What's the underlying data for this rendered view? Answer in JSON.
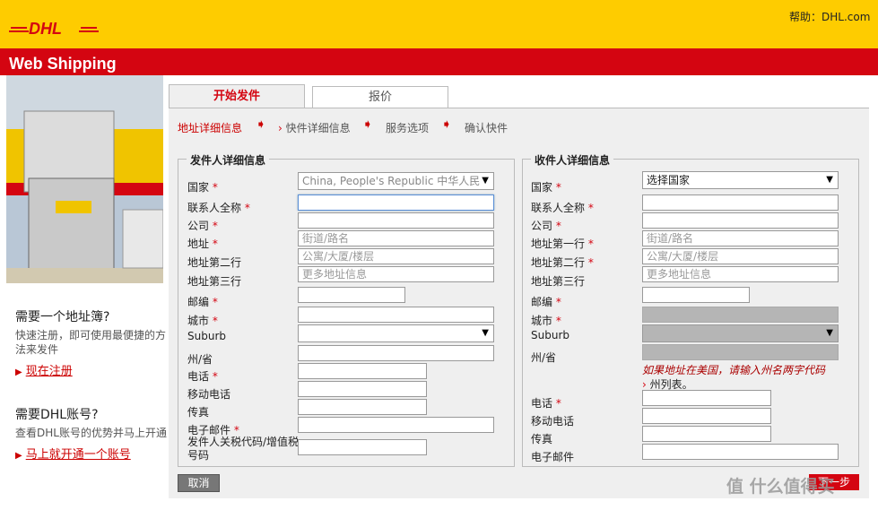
{
  "header": {
    "help": "帮助：DHL.com",
    "brand": "Web Shipping",
    "logo_text": "DHL"
  },
  "sidebar": {
    "addressbook_title": "需要一个地址簿?",
    "addressbook_text": "快速注册，即可使用最便捷的方法来发件",
    "addressbook_link": "现在注册",
    "account_title": "需要DHL账号?",
    "account_text": "查看DHL账号的优势并马上开通",
    "account_link": "马上就开通一个账号"
  },
  "tabs": [
    "开始发件",
    "报价"
  ],
  "steps": [
    "地址详细信息",
    "快件详细信息",
    "服务选项",
    "确认快件"
  ],
  "shipper": {
    "legend": "发件人详细信息",
    "labels": {
      "country": "国家",
      "contact": "联系人全称",
      "company": "公司",
      "address": "地址",
      "address2": "地址第二行",
      "address3": "地址第三行",
      "postcode": "邮编",
      "city": "城市",
      "suburb": "Suburb",
      "state": "州/省",
      "phone": "电话",
      "mobile": "移动电话",
      "fax": "传真",
      "email": "电子邮件",
      "taxid": "发件人关税代码/增值税号码"
    },
    "country_value": "China, People's Republic 中华人民",
    "placeholders": {
      "street": "街道/路名",
      "building": "公寓/大厦/楼层",
      "more": "更多地址信息"
    }
  },
  "receiver": {
    "legend": "收件人详细信息",
    "labels": {
      "country": "国家",
      "contact": "联系人全称",
      "company": "公司",
      "address": "地址第一行",
      "address2": "地址第二行",
      "address3": "地址第三行",
      "postcode": "邮编",
      "city": "城市",
      "suburb": "Suburb",
      "state": "州/省",
      "phone": "电话",
      "mobile": "移动电话",
      "fax": "传真",
      "email": "电子邮件"
    },
    "country_value": "选择国家",
    "placeholders": {
      "street": "街道/路名",
      "building": "公寓/大厦/楼层",
      "more": "更多地址信息"
    },
    "us_note": "如果地址在美国，请输入州名两字代码",
    "state_list_link": "州列表。"
  },
  "buttons": {
    "cancel": "取消",
    "next": "下一步"
  },
  "watermark": "值 什么值得买",
  "colors": {
    "dhl_yellow": "#fecc00",
    "dhl_red": "#d40511",
    "panel_bg": "#efefef"
  }
}
